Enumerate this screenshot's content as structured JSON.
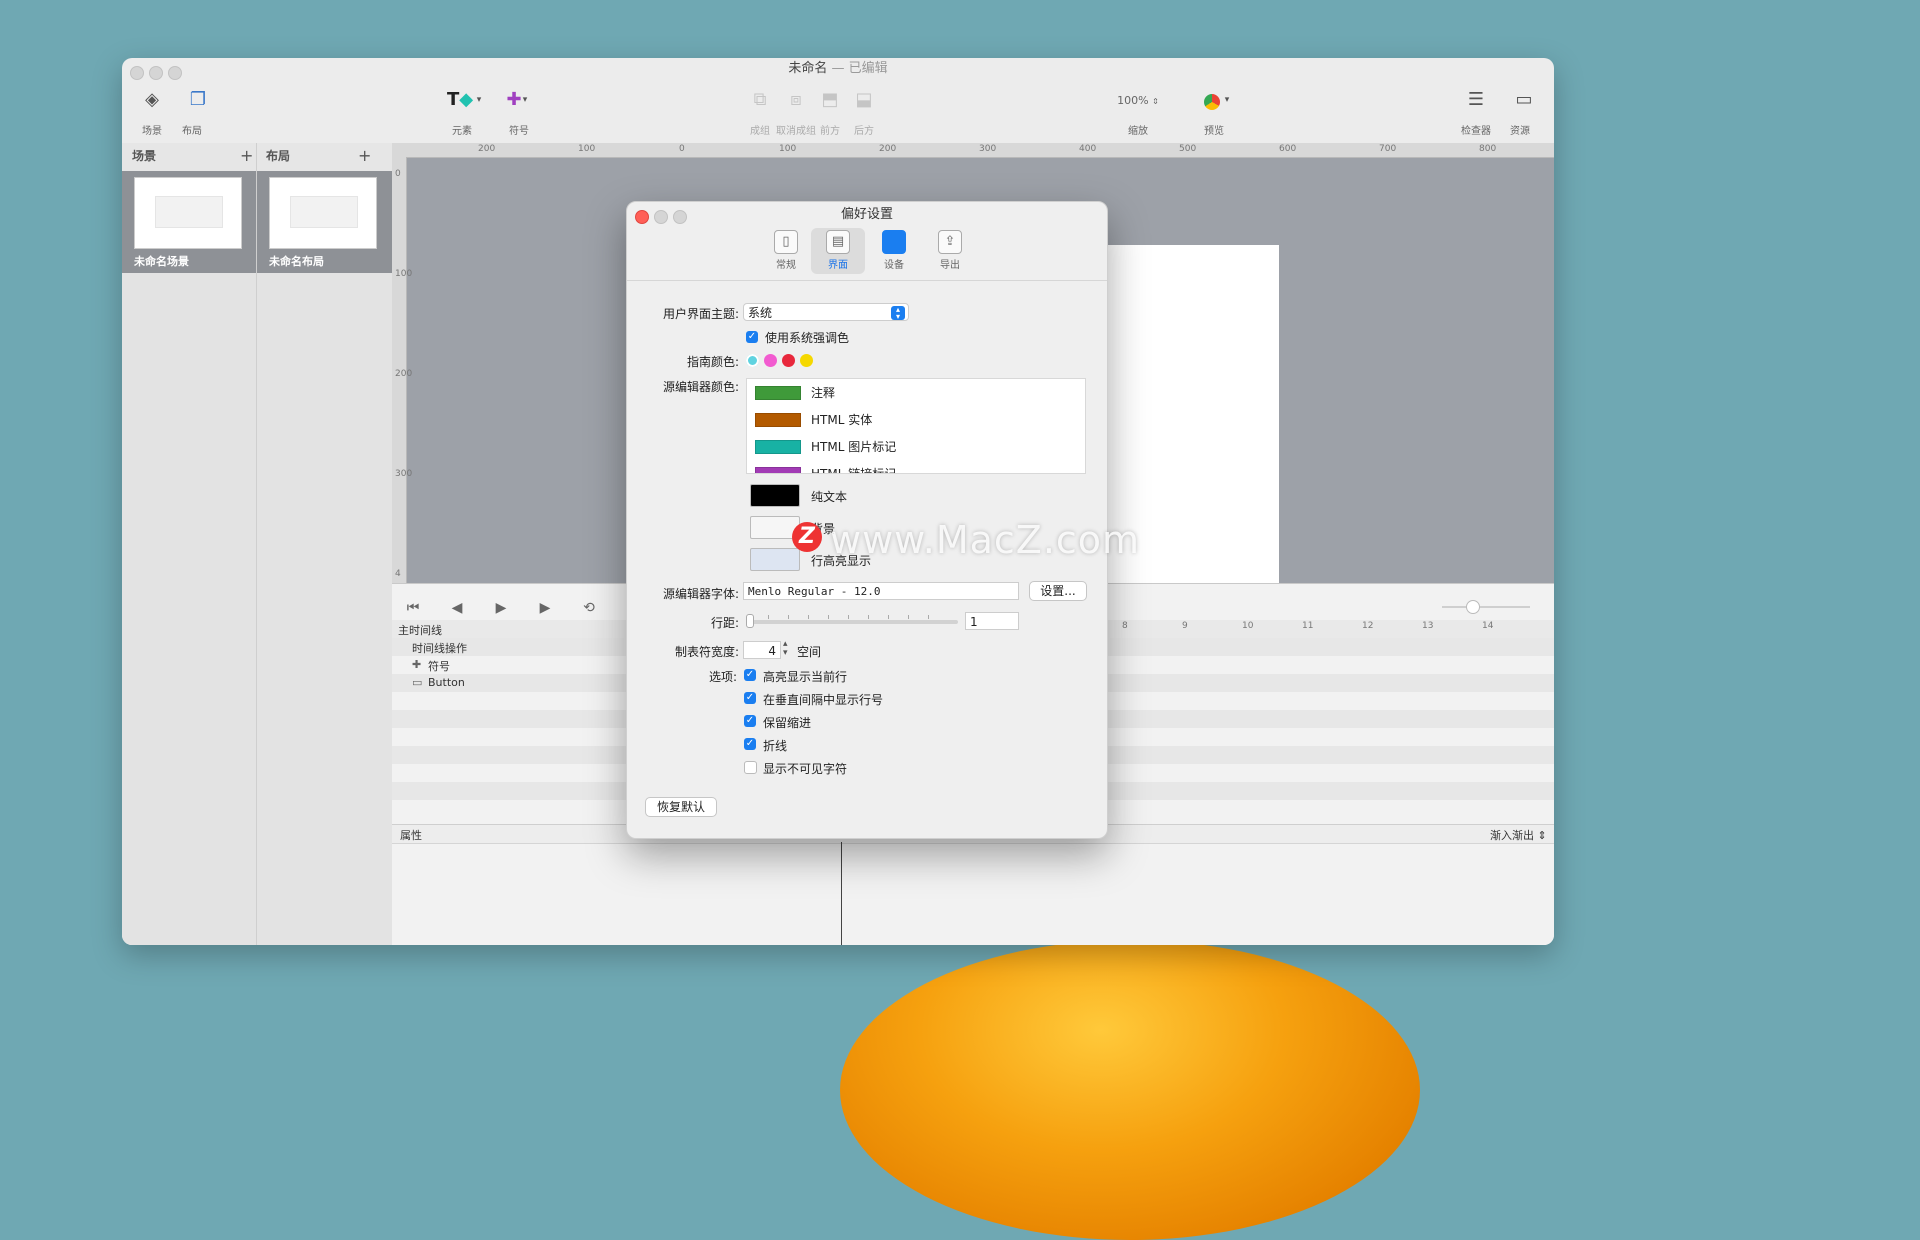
{
  "window": {
    "title": "未命名",
    "title_suffix": "— 已编辑"
  },
  "toolbar": {
    "scene_label": "场景",
    "layout_label": "布局",
    "elements_label": "元素",
    "symbols_label": "符号",
    "group_label": "成组",
    "ungroup_label": "取消成组",
    "front_label": "前方",
    "back_label": "后方",
    "zoom_value": "100%",
    "zoom_label": "缩放",
    "preview_label": "预览",
    "inspector_label": "检查器",
    "resources_label": "资源"
  },
  "scenes_panel": {
    "title": "场景",
    "add": "+",
    "items": [
      {
        "label": "未命名场景"
      }
    ]
  },
  "layouts_panel": {
    "title": "布局",
    "add": "+",
    "items": [
      {
        "label": "未命名布局"
      }
    ]
  },
  "ruler": {
    "top": [
      "200",
      "100",
      "0",
      "100",
      "200",
      "300",
      "400",
      "500",
      "600",
      "700",
      "800"
    ],
    "left": [
      "0",
      "100",
      "200",
      "300",
      "4"
    ]
  },
  "timeline": {
    "rows": [
      {
        "label": "主时间线"
      },
      {
        "label": "时间线操作"
      },
      {
        "label": "符号"
      },
      {
        "label": "Button"
      }
    ],
    "ticks": [
      "8",
      "9",
      "10",
      "11",
      "12",
      "13",
      "14"
    ],
    "attributes_label": "属性",
    "easing_label": "渐入渐出"
  },
  "prefs": {
    "title": "偏好设置",
    "tabs": [
      {
        "label": "常规",
        "active": false
      },
      {
        "label": "界面",
        "active": true
      },
      {
        "label": "设备",
        "active": false
      },
      {
        "label": "导出",
        "active": false
      }
    ],
    "theme_label": "用户界面主题:",
    "theme_value": "系统",
    "system_accent_label": "使用系统强调色",
    "guide_color_label": "指南颜色:",
    "guide_colors": [
      "#5fd3e0",
      "#f25bd0",
      "#e8283c",
      "#f5d800"
    ],
    "source_color_label": "源编辑器颜色:",
    "source_colors": [
      {
        "name": "注释",
        "color": "#3f9a3a"
      },
      {
        "name": "HTML 实体",
        "color": "#b35a00"
      },
      {
        "name": "HTML 图片标记",
        "color": "#18b2a4"
      },
      {
        "name": "HTML 链接标记",
        "color": "#a23bb5"
      }
    ],
    "plain_text_label": "纯文本",
    "plain_text_color": "#000000",
    "background_label": "背景",
    "highlight_label": "行高亮显示",
    "font_label": "源编辑器字体:",
    "font_value": "Menlo Regular - 12.0",
    "font_button": "设置...",
    "line_spacing_label": "行距:",
    "line_spacing_value": "1",
    "line_spacing_fraction": 0.0,
    "tab_width_label": "制表符宽度:",
    "tab_width_value": "4",
    "tab_width_unit": "空间",
    "options_label": "选项:",
    "options": [
      {
        "label": "高亮显示当前行",
        "checked": true
      },
      {
        "label": "在垂直间隔中显示行号",
        "checked": true
      },
      {
        "label": "保留缩进",
        "checked": true
      },
      {
        "label": "折线",
        "checked": true
      },
      {
        "label": "显示不可见字符",
        "checked": false
      }
    ],
    "restore_button": "恢复默认"
  },
  "watermark": {
    "logo": "Z",
    "text": "www.MacZ.com"
  }
}
